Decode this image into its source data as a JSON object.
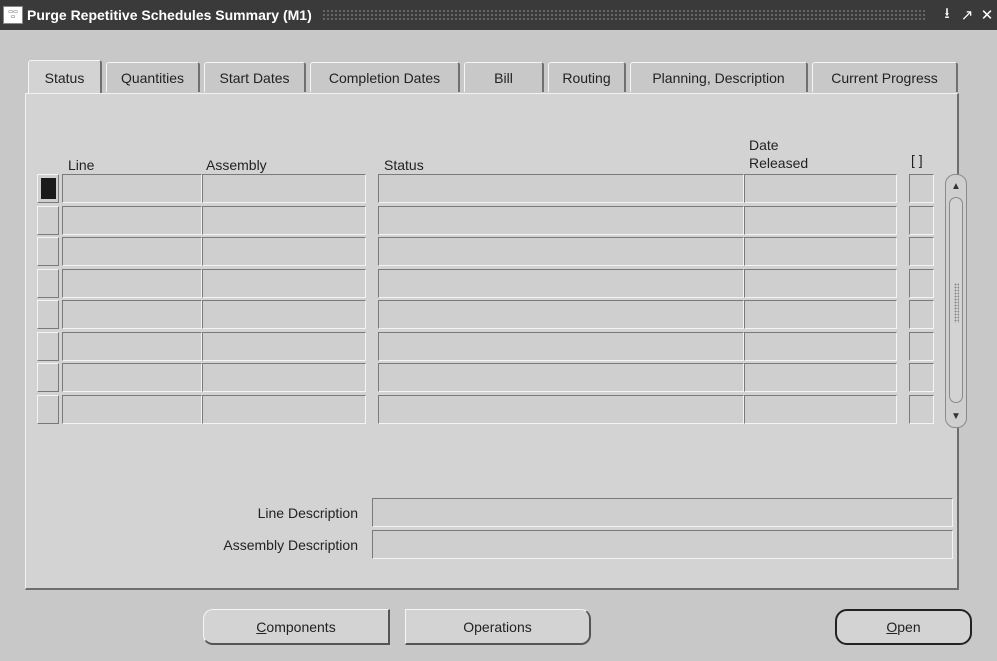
{
  "window": {
    "title": "Purge Repetitive Schedules Summary (M1)",
    "controls": [
      "↓",
      "↗",
      "✕"
    ]
  },
  "tabs": [
    {
      "label": "Status",
      "active": true
    },
    {
      "label": "Quantities"
    },
    {
      "label": "Start Dates"
    },
    {
      "label": "Completion Dates"
    },
    {
      "label": "Bill"
    },
    {
      "label": "Routing"
    },
    {
      "label": "Planning, Description"
    },
    {
      "label": "Current Progress"
    }
  ],
  "table": {
    "columns": {
      "line": "Line",
      "assembly": "Assembly",
      "status": "Status",
      "date_released_1": "Date",
      "date_released_2": "Released",
      "flex": "[ ]"
    },
    "row_count": 8
  },
  "details": {
    "line_description_label": "Line Description",
    "line_description_value": "",
    "assembly_description_label": "Assembly Description",
    "assembly_description_value": ""
  },
  "buttons": {
    "components_access_key": "C",
    "components_rest": "omponents",
    "operations": "Operations",
    "open_access_key": "O",
    "open_rest": "pen"
  }
}
